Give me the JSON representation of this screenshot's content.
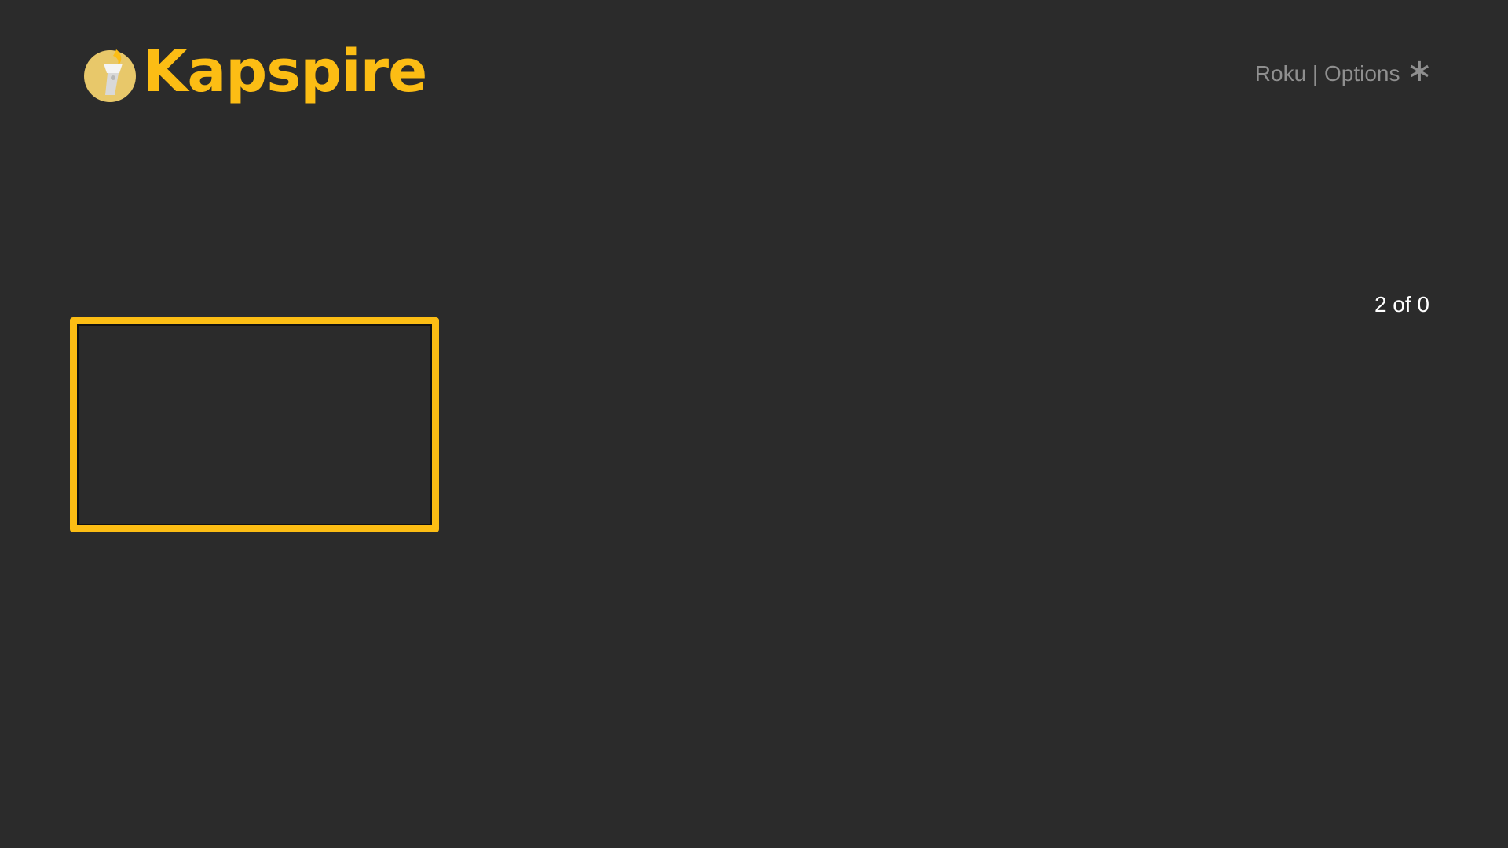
{
  "header": {
    "logo_text": "Kapspire",
    "options_text": "Roku | Options",
    "options_icon": "asterisk-icon"
  },
  "grid": {
    "counter": "2 of 0"
  },
  "colors": {
    "background": "#2b2b2b",
    "accent": "#fcbd14",
    "muted_text": "#8f8f8f",
    "text": "#ffffff"
  }
}
